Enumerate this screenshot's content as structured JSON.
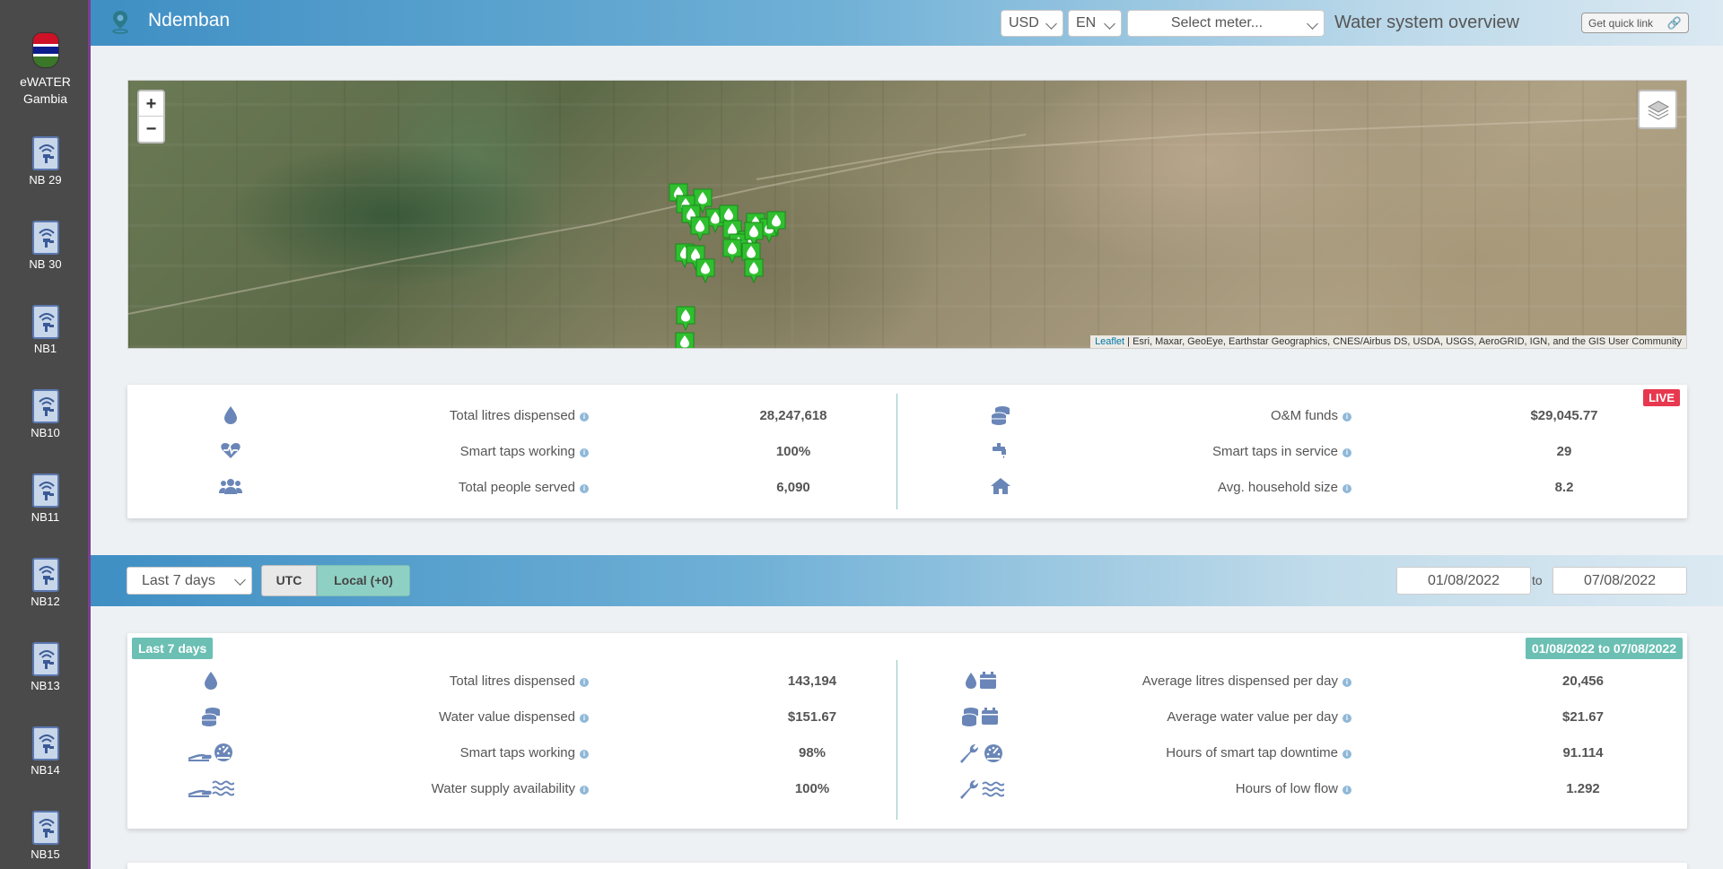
{
  "sidebar": {
    "org_line1": "eWATER",
    "org_line2": "Gambia",
    "items": [
      {
        "label": "NB 29"
      },
      {
        "label": "NB 30"
      },
      {
        "label": "NB1"
      },
      {
        "label": "NB10"
      },
      {
        "label": "NB11"
      },
      {
        "label": "NB12"
      },
      {
        "label": "NB13"
      },
      {
        "label": "NB14"
      },
      {
        "label": "NB15"
      }
    ]
  },
  "header": {
    "location": "Ndemban",
    "currency": "USD",
    "language": "EN",
    "meter_placeholder": "Select meter...",
    "title": "Water system overview",
    "quick_link": "Get quick link"
  },
  "map": {
    "zoom_in": "+",
    "zoom_out": "−",
    "attribution_leaflet": "Leaflet",
    "attribution_rest": " | Esri, Maxar, GeoEye, Earthstar Geographics, CNES/Airbus DS, USDA, USGS, AeroGRID, IGN, and the GIS User Community",
    "marker_color": "#2fbf2f"
  },
  "live_stats": {
    "badge": "LIVE",
    "left": [
      {
        "icon": "water-drop-icon",
        "label": "Total litres dispensed",
        "value": "28,247,618"
      },
      {
        "icon": "heartbeat-icon",
        "label": "Smart taps working",
        "value": "100%"
      },
      {
        "icon": "people-icon",
        "label": "Total people served",
        "value": "6,090"
      }
    ],
    "right": [
      {
        "icon": "coins-icon",
        "label": "O&M funds",
        "value": "$29,045.77"
      },
      {
        "icon": "tap-icon",
        "label": "Smart taps in service",
        "value": "29"
      },
      {
        "icon": "house-icon",
        "label": "Avg. household size",
        "value": "8.2"
      }
    ]
  },
  "filter": {
    "period": "Last 7 days",
    "utc": "UTC",
    "local": "Local (+0)",
    "date_from": "01/08/2022",
    "to": "to",
    "date_to": "07/08/2022"
  },
  "period_stats": {
    "tag_left": "Last 7 days",
    "tag_right": "01/08/2022 to 07/08/2022",
    "left": [
      {
        "icon": "water-drop-icon",
        "label": "Total litres dispensed",
        "value": "143,194"
      },
      {
        "icon": "coins-icon",
        "label": "Water value dispensed",
        "value": "$151.67"
      },
      {
        "icon": "gauge-hand-icon",
        "label": "Smart taps working",
        "value": "98%"
      },
      {
        "icon": "water-wave-hand-icon",
        "label": "Water supply availability",
        "value": "100%"
      }
    ],
    "right": [
      {
        "icon": "drop-calendar-icon",
        "label": "Average litres dispensed per day",
        "value": "20,456"
      },
      {
        "icon": "coins-calendar-icon",
        "label": "Average water value per day",
        "value": "$21.67"
      },
      {
        "icon": "wrench-gauge-icon",
        "label": "Hours of smart tap downtime",
        "value": "91.114"
      },
      {
        "icon": "wrench-wave-icon",
        "label": "Hours of low flow",
        "value": "1.292"
      }
    ]
  },
  "colors": {
    "accent_blue": "#3f8fc4",
    "icon_blue": "#6a86b8",
    "teal": "#6bbfb3",
    "live_red": "#e8384f"
  }
}
